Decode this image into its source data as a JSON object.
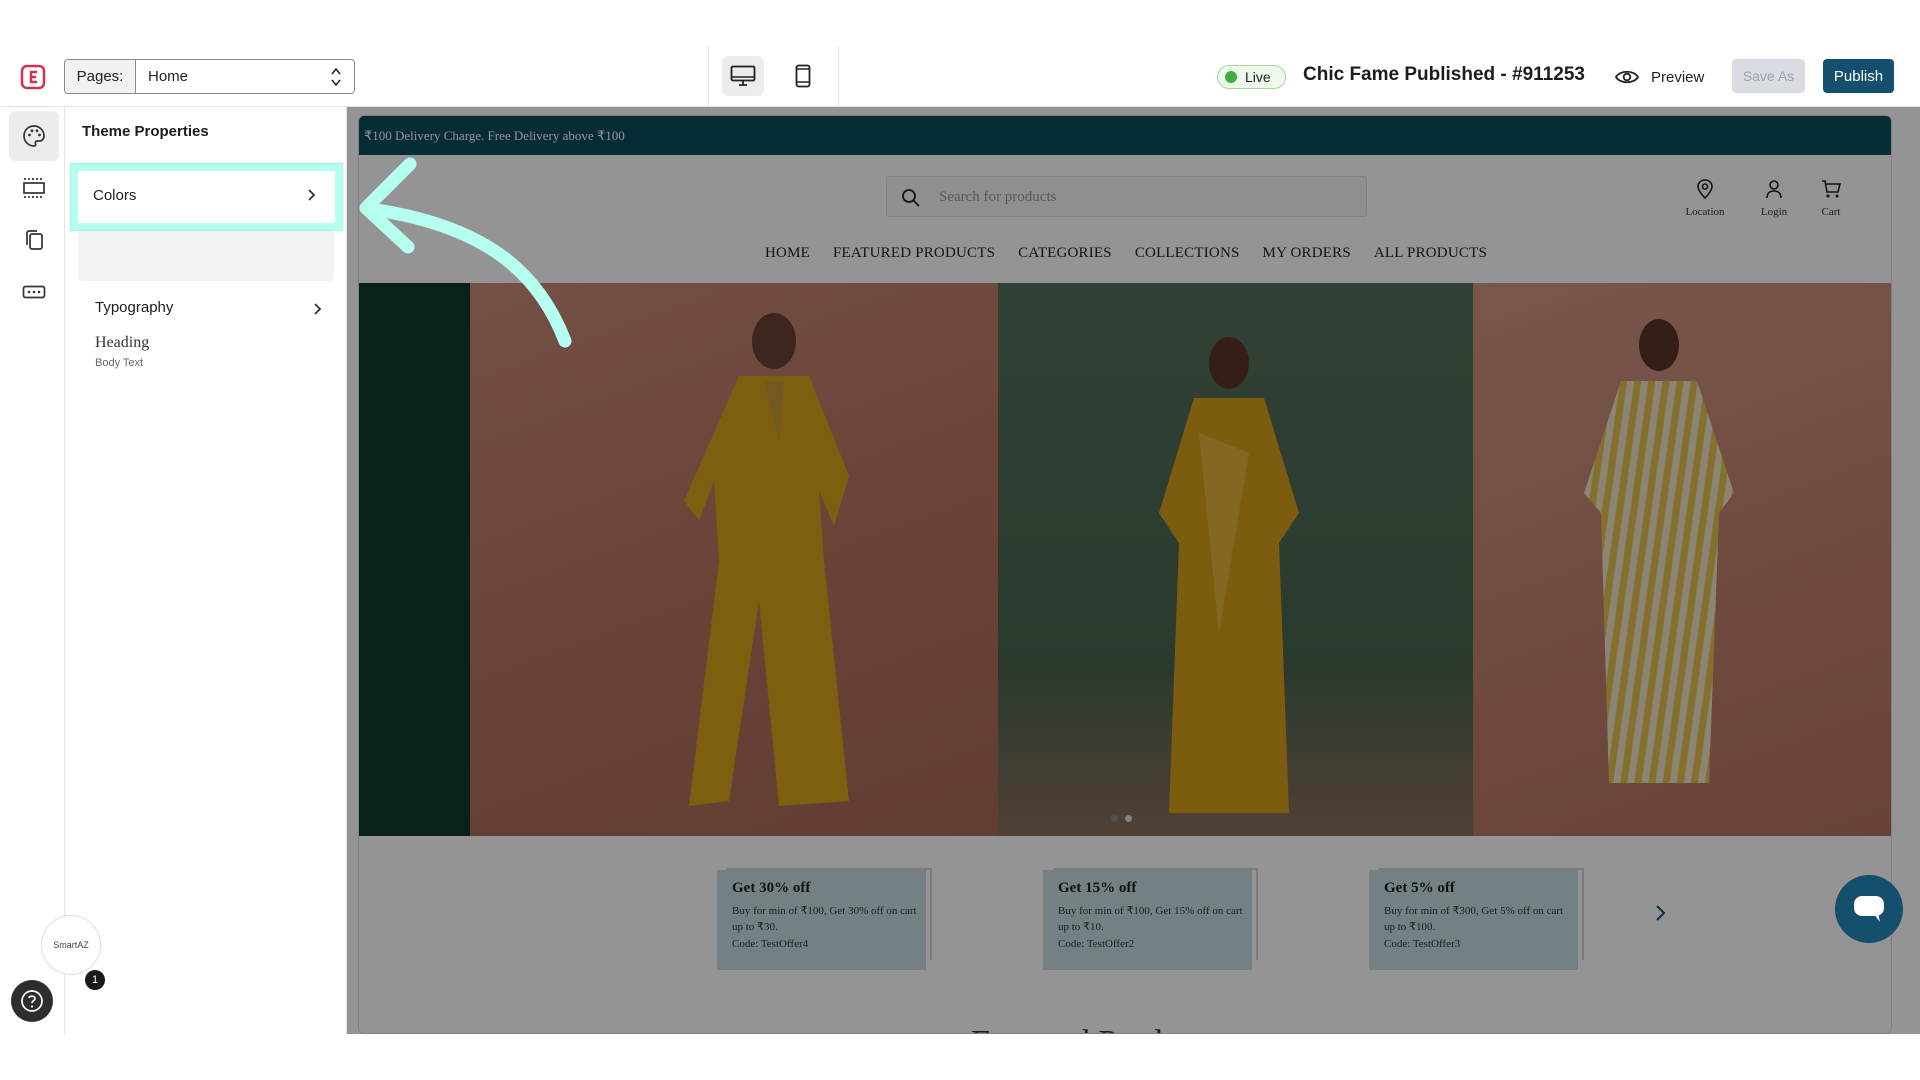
{
  "topbar": {
    "pages_label": "Pages:",
    "pages_value": "Home",
    "live_label": "Live",
    "theme_title": "Chic Fame Published - #911253",
    "preview_label": "Preview",
    "save_as_label": "Save As",
    "publish_label": "Publish",
    "accent_color": "#14506e"
  },
  "panel": {
    "title": "Theme Properties",
    "colors_label": "Colors",
    "swatches": [
      "#0f5064",
      "#e9edf0",
      "#0a3844"
    ],
    "typography_label": "Typography",
    "heading_sample": "Heading",
    "body_sample": "Body Text"
  },
  "rail": {
    "widget_label": "SmartAZ",
    "notification_count": "1"
  },
  "store": {
    "announcement": "₹100 Delivery Charge. Free Delivery above ₹100",
    "search_placeholder": "Search for products",
    "header_icons": [
      {
        "label": "Location",
        "icon": "location-pin-icon"
      },
      {
        "label": "Login",
        "icon": "user-icon"
      },
      {
        "label": "Cart",
        "icon": "cart-icon"
      }
    ],
    "menu": [
      "HOME",
      "FEATURED PRODUCTS",
      "CATEGORIES",
      "COLLECTIONS",
      "MY ORDERS",
      "ALL PRODUCTS"
    ],
    "offers": [
      {
        "title": "Get 30% off",
        "desc": "Buy for min of ₹100, Get 30% off on cart up to ₹30.",
        "code": "Code: TestOffer4"
      },
      {
        "title": "Get 15% off",
        "desc": "Buy for min of ₹100, Get 15% off on cart up to ₹10.",
        "code": "Code: TestOffer2"
      },
      {
        "title": "Get 5% off",
        "desc": "Buy for min of ₹300, Get 5% off on cart up to ₹100.",
        "code": "Code: TestOffer3"
      }
    ],
    "section_heading_peek": "Featured Products",
    "carousel_active_dot": 2,
    "carousel_dot_count": 2,
    "announcement_color": "#0c4d5c"
  },
  "annotation": {
    "highlight_color": "#b4fff0"
  }
}
